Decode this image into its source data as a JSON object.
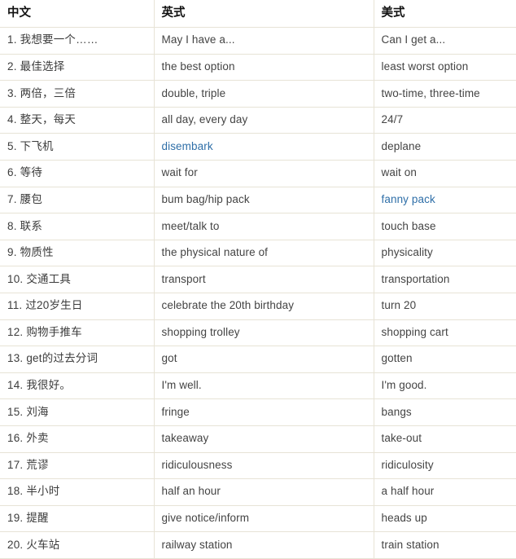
{
  "table": {
    "headers": [
      {
        "label": "中文",
        "name": "column-header-chinese"
      },
      {
        "label": "英式",
        "name": "column-header-british"
      },
      {
        "label": "美式",
        "name": "column-header-american"
      }
    ],
    "rows": [
      {
        "index": "1.",
        "chinese": "我想要一个……",
        "british": "May I have a...",
        "american": "Can I get a...",
        "british_highlight": false,
        "american_highlight": false
      },
      {
        "index": "2.",
        "chinese": "最佳选择",
        "british": "the best option",
        "american": "least worst option",
        "british_highlight": false,
        "american_highlight": false
      },
      {
        "index": "3.",
        "chinese": "两倍，三倍",
        "british": "double, triple",
        "american": "two-time, three-time",
        "british_highlight": false,
        "american_highlight": false
      },
      {
        "index": "4.",
        "chinese": "整天，每天",
        "british": "all day, every day",
        "american": "24/7",
        "british_highlight": false,
        "american_highlight": false
      },
      {
        "index": "5.",
        "chinese": "下飞机",
        "british": "disembark",
        "american": "deplane",
        "british_highlight": true,
        "american_highlight": false
      },
      {
        "index": "6.",
        "chinese": "等待",
        "british": "wait for",
        "american": "wait on",
        "british_highlight": false,
        "american_highlight": false
      },
      {
        "index": "7.",
        "chinese": "腰包",
        "british": "bum bag/hip pack",
        "american": "fanny pack",
        "british_highlight": false,
        "american_highlight": true
      },
      {
        "index": "8.",
        "chinese": "联系",
        "british": "meet/talk to",
        "american": "touch base",
        "british_highlight": false,
        "american_highlight": false
      },
      {
        "index": "9.",
        "chinese": "物质性",
        "british": "the physical nature of",
        "american": "physicality",
        "british_highlight": false,
        "american_highlight": false
      },
      {
        "index": "10.",
        "chinese": "交通工具",
        "british": "transport",
        "american": "transportation",
        "british_highlight": false,
        "american_highlight": false
      },
      {
        "index": "11.",
        "chinese": "过20岁生日",
        "british": "celebrate the 20th birthday",
        "american": "turn 20",
        "british_highlight": false,
        "american_highlight": false
      },
      {
        "index": "12.",
        "chinese": "购物手推车",
        "british": "shopping trolley",
        "american": "shopping cart",
        "british_highlight": false,
        "american_highlight": false
      },
      {
        "index": "13.",
        "chinese": "get的过去分词",
        "british": "got",
        "american": "gotten",
        "british_highlight": false,
        "american_highlight": false
      },
      {
        "index": "14.",
        "chinese": "我很好。",
        "british": "I'm well.",
        "american": "I'm good.",
        "british_highlight": false,
        "american_highlight": false
      },
      {
        "index": "15.",
        "chinese": "刘海",
        "british": "fringe",
        "american": "bangs",
        "british_highlight": false,
        "american_highlight": false
      },
      {
        "index": "16.",
        "chinese": "外卖",
        "british": "takeaway",
        "american": "take-out",
        "british_highlight": false,
        "american_highlight": false
      },
      {
        "index": "17.",
        "chinese": "荒谬",
        "british": "ridiculousness",
        "american": "ridiculosity",
        "british_highlight": false,
        "american_highlight": false
      },
      {
        "index": "18.",
        "chinese": "半小时",
        "british": "half an hour",
        "american": "a half hour",
        "british_highlight": false,
        "american_highlight": false
      },
      {
        "index": "19.",
        "chinese": "提醒",
        "british": "give notice/inform",
        "american": "heads up",
        "british_highlight": false,
        "american_highlight": false
      },
      {
        "index": "20.",
        "chinese": "火车站",
        "british": "railway station",
        "american": "train station",
        "british_highlight": false,
        "american_highlight": false
      }
    ]
  },
  "colors": {
    "border": "#e7e3d6",
    "body_text": "#3c3c3c",
    "header_text": "#111111",
    "highlight_link": "#2f6fa8",
    "background": "#ffffff"
  }
}
